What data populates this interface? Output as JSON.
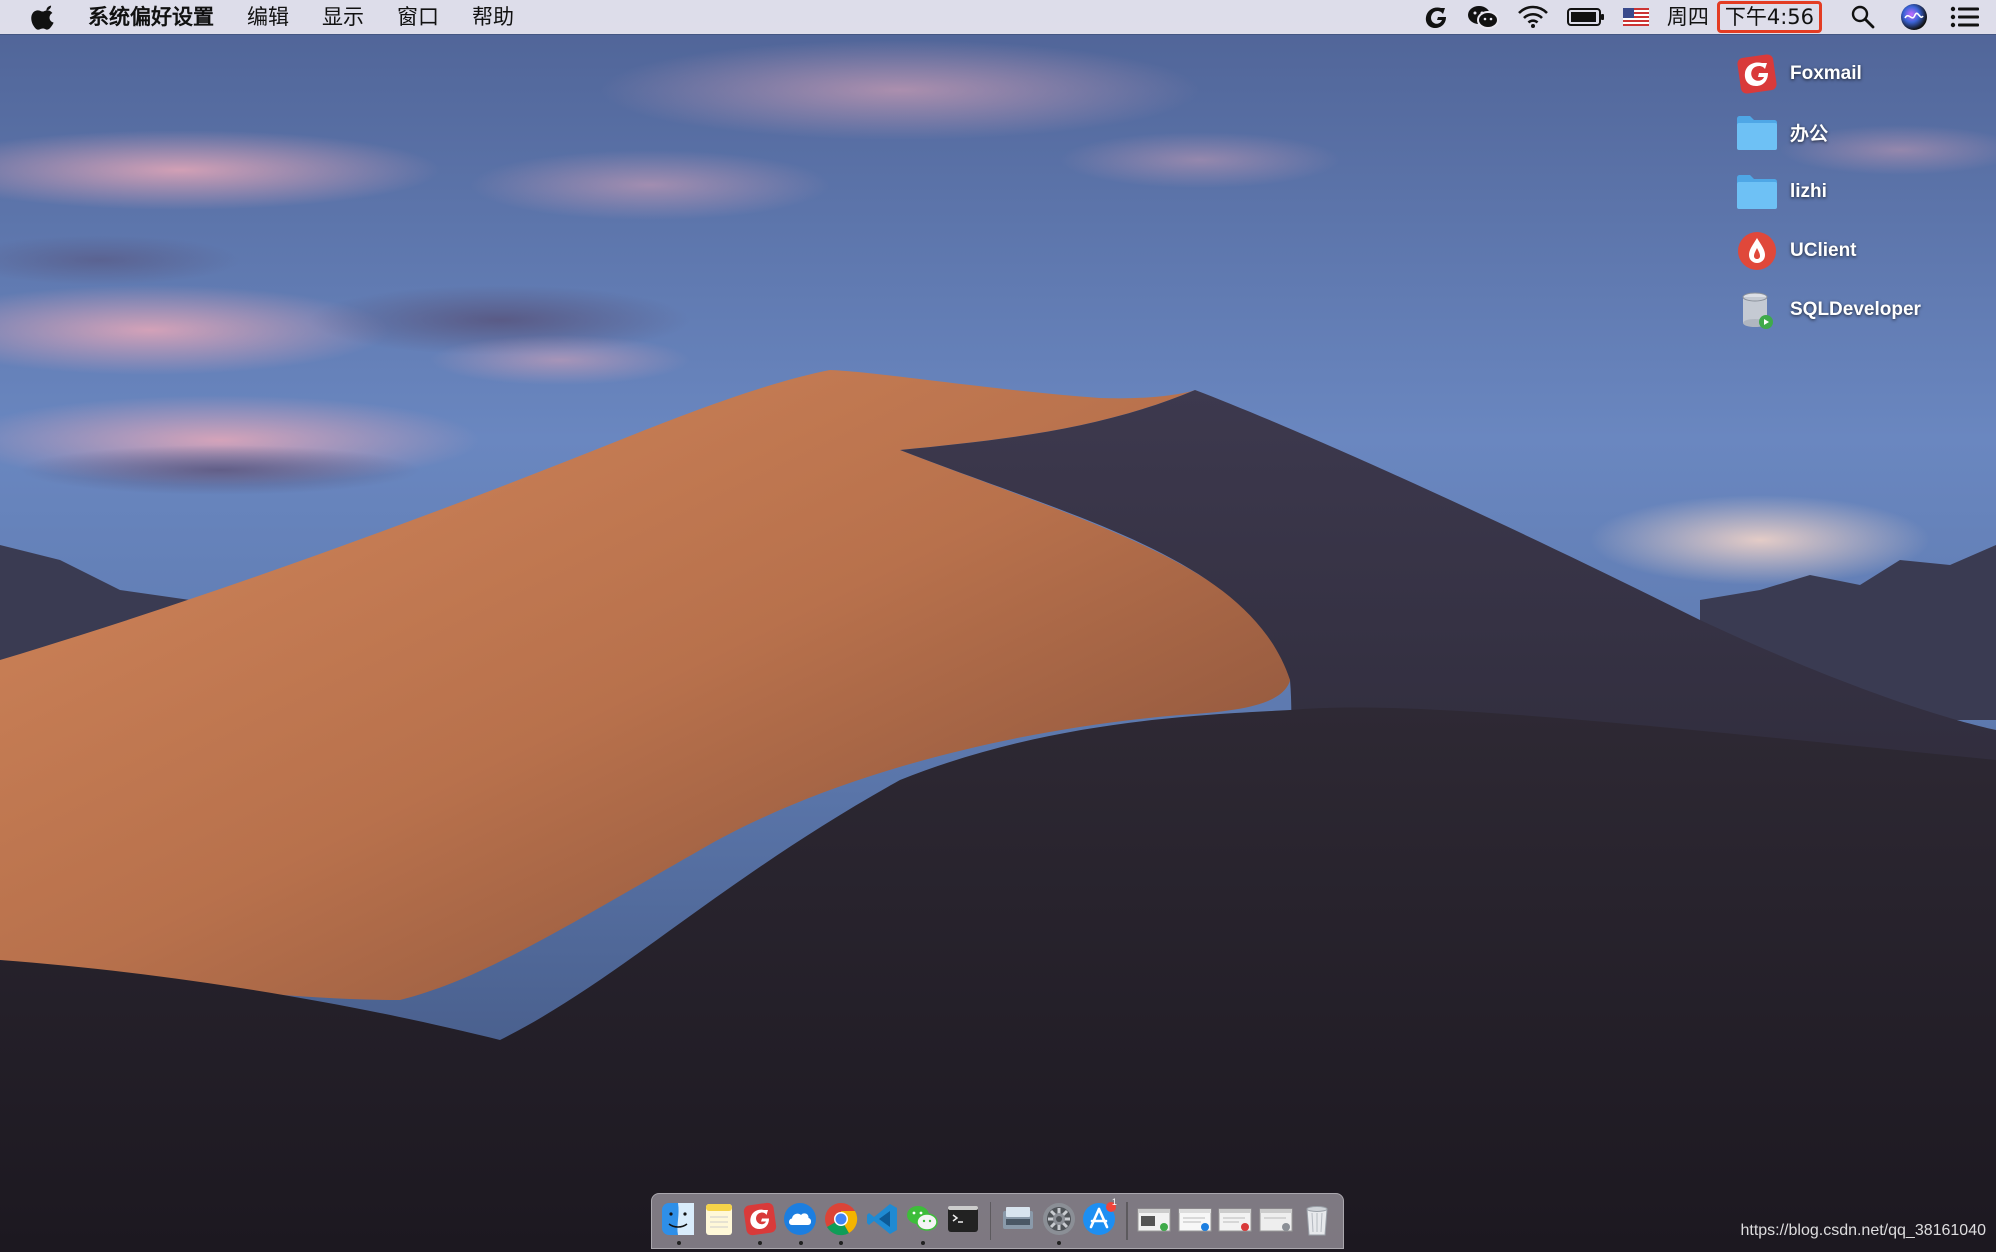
{
  "menubar": {
    "app_name": "系统偏好设置",
    "menus": [
      "编辑",
      "显示",
      "窗口",
      "帮助"
    ],
    "status_icons": [
      "foxmail-icon",
      "wechat-icon",
      "wifi-icon",
      "battery-icon",
      "us-flag-icon"
    ],
    "weekday": "周四",
    "time": "下午4:56",
    "highlight_color": "#e33c23"
  },
  "desktop": {
    "items": [
      {
        "label": "Foxmail",
        "icon": "foxmail-icon"
      },
      {
        "label": "办公",
        "icon": "folder-icon"
      },
      {
        "label": "lizhi",
        "icon": "folder-icon"
      },
      {
        "label": "UClient",
        "icon": "uclient-icon"
      },
      {
        "label": "SQLDeveloper",
        "icon": "sqldeveloper-icon"
      }
    ]
  },
  "dock": {
    "apps": [
      {
        "icon": "finder-icon",
        "running": true
      },
      {
        "icon": "notes-icon",
        "running": false
      },
      {
        "icon": "foxmail-icon",
        "running": true
      },
      {
        "icon": "cloud-icon",
        "running": true
      },
      {
        "icon": "chrome-icon",
        "running": true
      },
      {
        "icon": "vscode-icon",
        "running": false
      },
      {
        "icon": "wechat-icon",
        "running": true
      },
      {
        "icon": "terminal-icon",
        "running": false
      },
      {
        "icon": "image-capture-icon",
        "running": false
      },
      {
        "icon": "system-preferences-icon",
        "running": true
      },
      {
        "icon": "app-store-icon",
        "running": false,
        "badge": "1"
      }
    ],
    "windows": [
      "minimized-window-icon",
      "minimized-window-icon",
      "minimized-window-icon",
      "minimized-window-icon"
    ],
    "trash": "trash-icon"
  },
  "watermark": "https://blog.csdn.net/qq_38161040"
}
